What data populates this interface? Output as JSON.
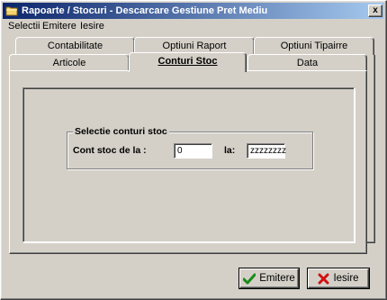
{
  "window": {
    "title": "Rapoarte / Stocuri - Descarcare Gestiune Pret Mediu",
    "close_label": "x"
  },
  "menu": {
    "items": [
      {
        "label": "Selectii"
      },
      {
        "label": "Emitere"
      },
      {
        "label": "Iesire"
      }
    ]
  },
  "tabs": {
    "back_row": [
      {
        "label": "Contabilitate"
      },
      {
        "label": "Optiuni Raport"
      },
      {
        "label": "Optiuni Tipairre"
      }
    ],
    "front_row": [
      {
        "label": "Articole"
      },
      {
        "label": "Conturi Stoc",
        "active": true
      },
      {
        "label": "Data"
      }
    ]
  },
  "group": {
    "title": "Selectie conturi stoc",
    "from_label": "Cont stoc de la :",
    "from_value": "0",
    "to_label": "la:",
    "to_value": "zzzzzzzz"
  },
  "buttons": {
    "emit_label": "Emitere",
    "exit_label": "Iesire"
  },
  "colors": {
    "title_gradient_start": "#0a246a",
    "title_gradient_end": "#a6caf0",
    "face": "#d4d0c8",
    "emit_icon": "#1a8a1a",
    "exit_icon": "#d01010"
  },
  "icons": {
    "app": "folder-icon",
    "emit": "checkmark-icon",
    "exit": "x-cross-icon"
  }
}
